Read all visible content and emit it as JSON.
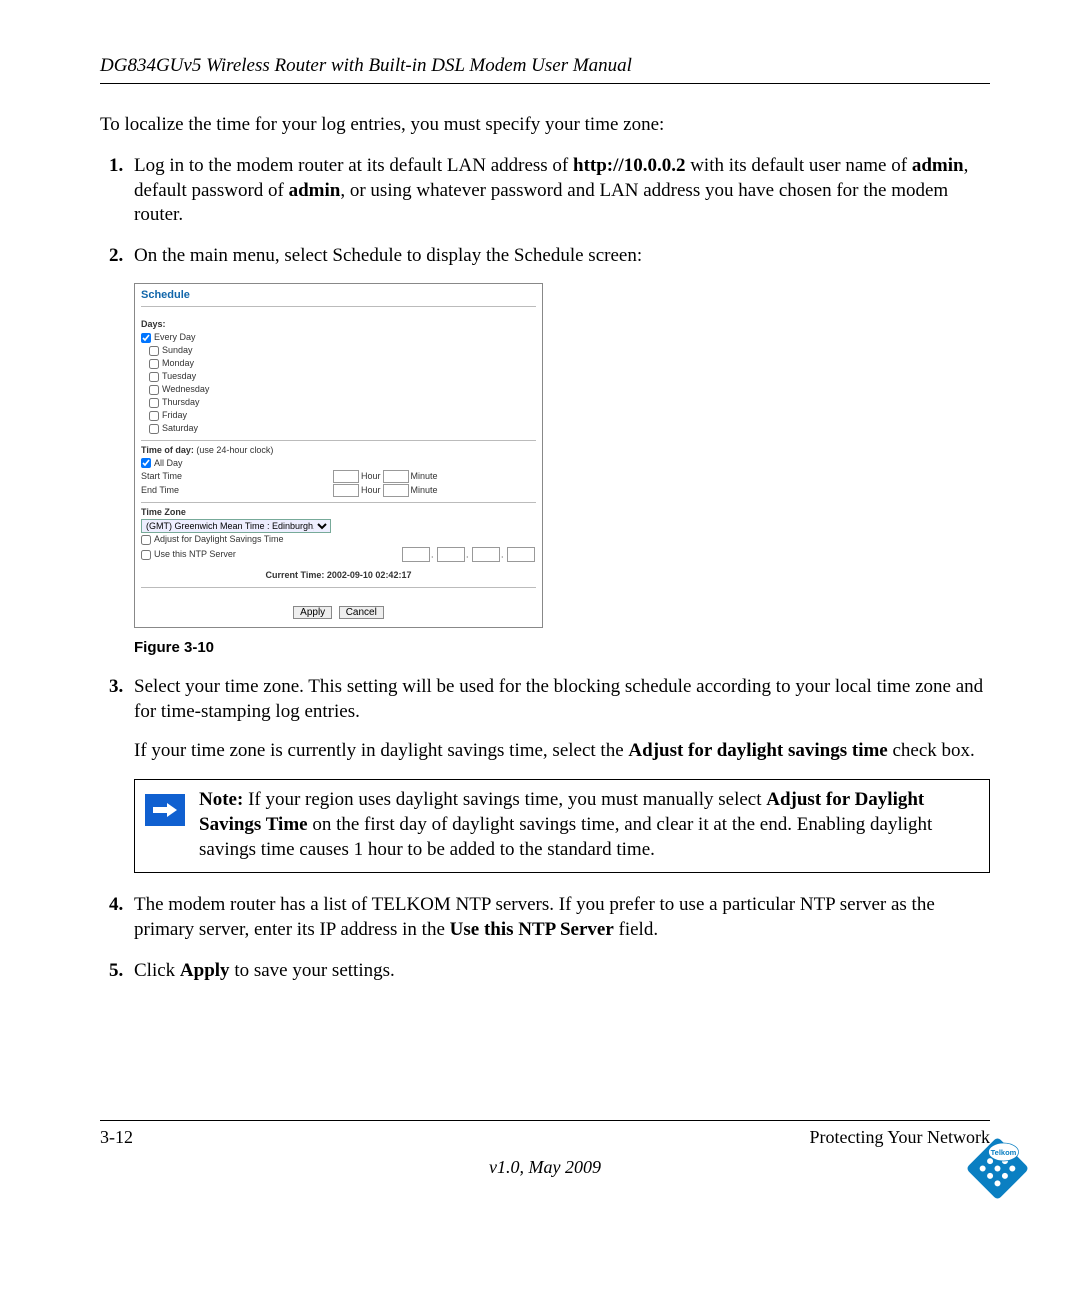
{
  "header": {
    "title": "DG834GUv5 Wireless Router with Built-in DSL Modem User Manual"
  },
  "intro": "To localize the time for your log entries, you must specify your time zone:",
  "step1": {
    "pre": "Log in to the modem router at its default LAN address of ",
    "url": "http://10.0.0.2",
    "mid1": " with its default user name of ",
    "admin1": "admin",
    "mid2": ", default password of ",
    "admin2": "admin",
    "post": ", or using whatever password and LAN address you have chosen for the modem router."
  },
  "step2": "On the main menu, select Schedule to display the Schedule screen:",
  "screenshot": {
    "title": "Schedule",
    "days_label": "Days:",
    "days": [
      "Every Day",
      "Sunday",
      "Monday",
      "Tuesday",
      "Wednesday",
      "Thursday",
      "Friday",
      "Saturday"
    ],
    "every_day_checked": true,
    "timeofday_label": "Time of day:",
    "timeofday_hint": " (use 24-hour clock)",
    "allday_label": "All Day",
    "allday_checked": true,
    "start_label": "Start Time",
    "end_label": "End Time",
    "hour_label": "Hour",
    "minute_label": "Minute",
    "tz_label": "Time Zone",
    "tz_value": "(GMT) Greenwich Mean Time : Edinburgh, London",
    "dst_label": "Adjust for Daylight Savings Time",
    "ntp_label": "Use this NTP Server",
    "current_time_label": "Current Time: ",
    "current_time_value": "2002-09-10 02:42:17",
    "apply": "Apply",
    "cancel": "Cancel"
  },
  "figure_caption": "Figure 3-10",
  "step3": {
    "p1": "Select your time zone. This setting will be used for the blocking schedule according to your local time zone and for time-stamping log entries.",
    "p2_pre": "If your time zone is currently in daylight savings time, select the ",
    "p2_bold": "Adjust for daylight savings time",
    "p2_post": " check box."
  },
  "note": {
    "label": "Note:",
    "pre": " If your region uses daylight savings time, you must manually select ",
    "bold": "Adjust for Daylight Savings Time",
    "post": " on the first day of daylight savings time, and clear it at the end. Enabling daylight savings time causes 1 hour to be added to the standard time."
  },
  "step4": {
    "pre": "The modem router has a list of TELKOM NTP servers. If you prefer to use a particular NTP server as the primary server, enter its IP address in the ",
    "bold": "Use this NTP Server",
    "post": " field."
  },
  "step5": {
    "pre": "Click ",
    "bold": "Apply",
    "post": " to save your settings."
  },
  "footer": {
    "page": "3-12",
    "section": "Protecting Your Network",
    "version": "v1.0, May 2009"
  },
  "logo_text": "Telkom"
}
